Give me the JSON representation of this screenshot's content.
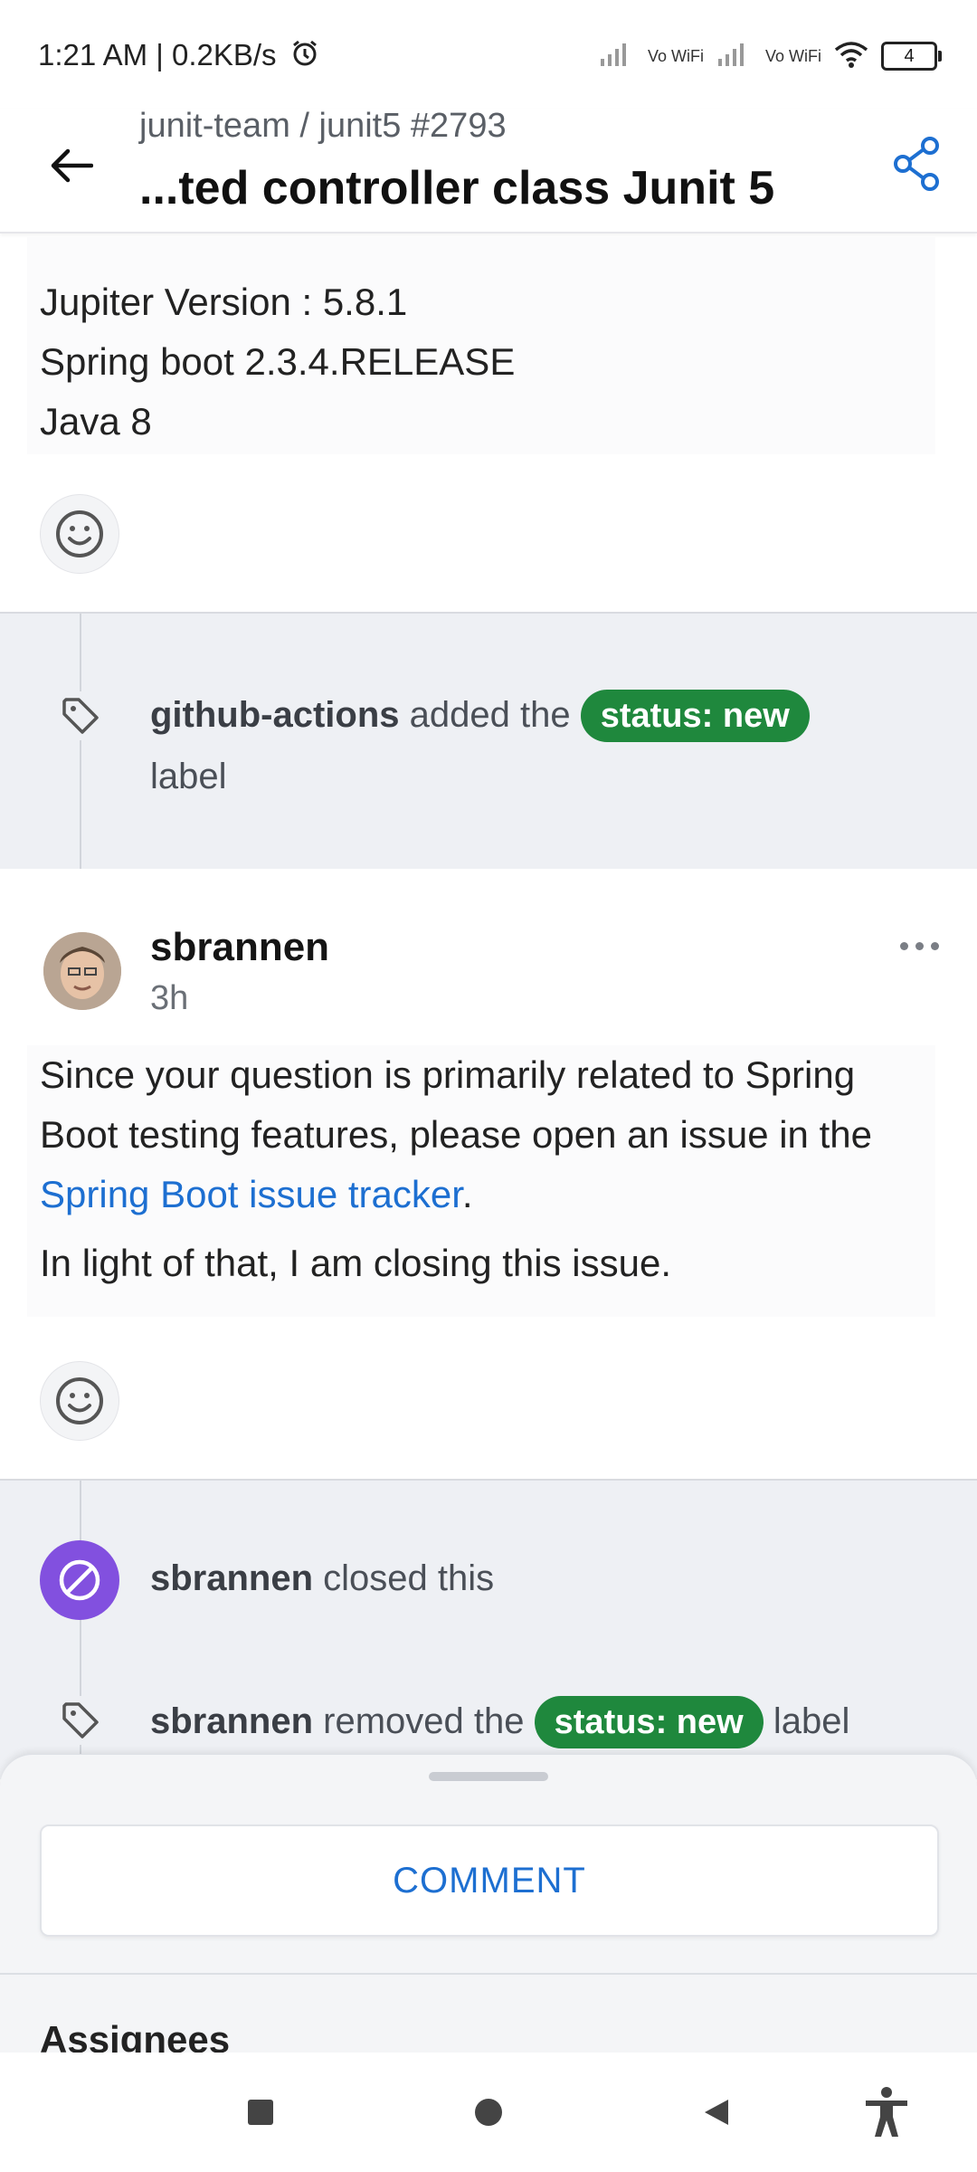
{
  "status_bar": {
    "time": "1:21 AM | 0.2KB/s",
    "alarm_icon": "alarm-icon",
    "network": [
      "Vo WiFi",
      "Vo WiFi"
    ],
    "battery": "4"
  },
  "header": {
    "repo": "junit-team / junit5 #2793",
    "title": "...ted controller class Junit 5",
    "back_icon": "arrow-left-icon",
    "share_icon": "share-icon"
  },
  "issue_body": {
    "lines": [
      "Jupiter Version : 5.8.1",
      "Spring boot 2.3.4.RELEASE",
      "Java 8"
    ]
  },
  "events": [
    {
      "actor": "github-actions",
      "action": "added the",
      "label": "status: new",
      "suffix": "label",
      "icon": "tag-icon"
    }
  ],
  "comment": {
    "author": "sbrannen",
    "time": "3h",
    "paragraph1_pre": "Since your question is primarily related to Spring Boot testing features, please open an issue in the ",
    "paragraph1_link": "Spring Boot issue tracker",
    "paragraph1_post": ".",
    "paragraph2": "In light of that, I am closing this issue."
  },
  "events_after": [
    {
      "actor": "sbrannen",
      "action": "closed this",
      "icon": "closed-circle-icon"
    },
    {
      "actor": "sbrannen",
      "action": "removed the",
      "label": "status: new",
      "suffix": "label",
      "icon": "tag-icon"
    }
  ],
  "bottom_sheet": {
    "comment_button": "COMMENT",
    "section_title": "Assignees"
  },
  "colors": {
    "accent": "#1d6fd1",
    "label_green": "#1f883d",
    "closed_purple": "#8250df",
    "timeline_bg": "#eef0f4"
  }
}
